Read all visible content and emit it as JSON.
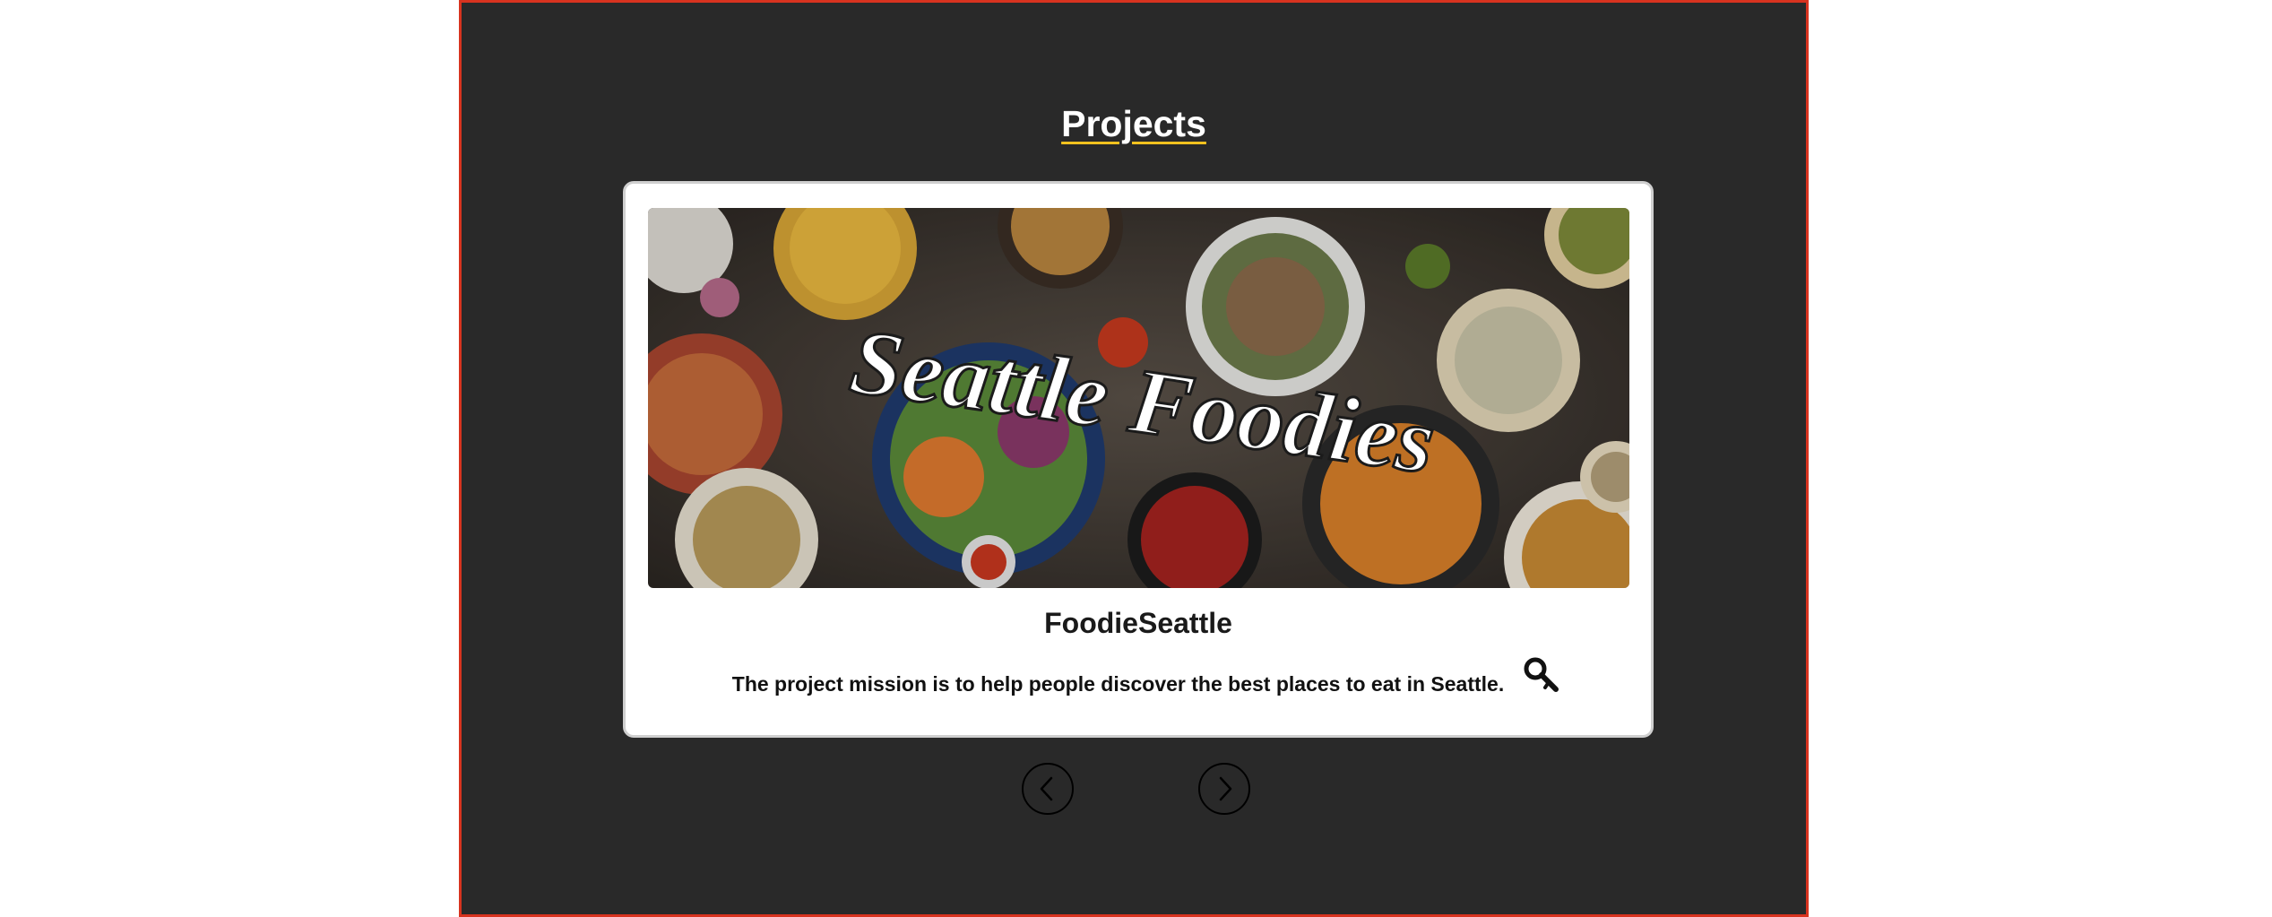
{
  "section": {
    "title": "Projects"
  },
  "project": {
    "banner_text": "Seattle Foodies",
    "name": "FoodieSeattle",
    "description": "The project mission is to help people discover the best places to eat in Seattle."
  },
  "icons": {
    "search": "magnifier-icon",
    "prev": "chevron-left-icon",
    "next": "chevron-right-icon"
  },
  "colors": {
    "section_bg": "#292929",
    "section_border": "#d7331f",
    "title_underline": "#f3c21f",
    "card_bg": "#ffffff"
  }
}
